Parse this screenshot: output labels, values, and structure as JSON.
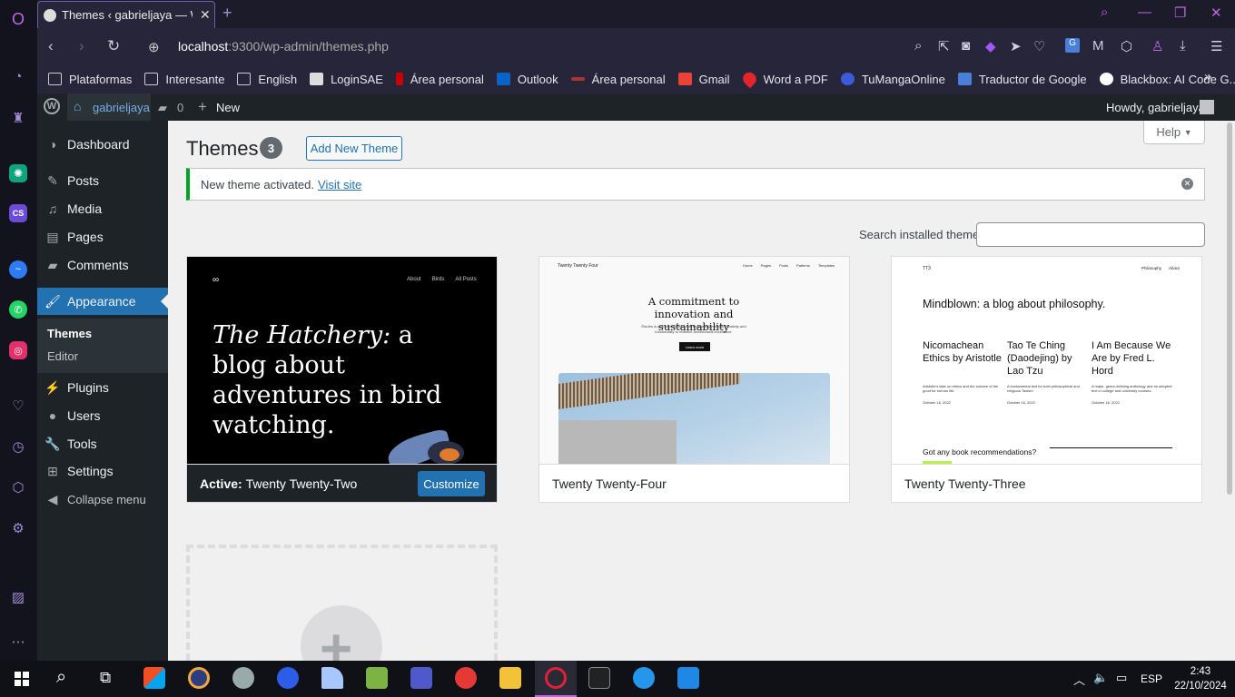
{
  "browser": {
    "tab_title": "Themes ‹ gabrieljaya — Wo",
    "url_host": "localhost",
    "url_path": ":9300/wp-admin/themes.php",
    "bookmarks": [
      "Plataformas",
      "Interesante",
      "English",
      "LoginSAE",
      "Área personal",
      "Outlook",
      "Área personal",
      "Gmail",
      "Word a PDF",
      "TuMangaOnline",
      "Traductor de Google",
      "Blackbox: AI Code G..."
    ]
  },
  "adminbar": {
    "site": "gabrieljaya",
    "comments": "0",
    "new": "New",
    "howdy": "Howdy, gabrieljaya"
  },
  "menu": {
    "dashboard": "Dashboard",
    "posts": "Posts",
    "media": "Media",
    "pages": "Pages",
    "comments": "Comments",
    "appearance": "Appearance",
    "themes": "Themes",
    "editor": "Editor",
    "plugins": "Plugins",
    "users": "Users",
    "tools": "Tools",
    "settings": "Settings",
    "collapse": "Collapse menu"
  },
  "page": {
    "title": "Themes",
    "count": "3",
    "add_new": "Add New Theme",
    "help": "Help",
    "notice": "New theme activated.",
    "visit_site": "Visit site",
    "search_label": "Search installed themes"
  },
  "themes": {
    "active_label": "Active:",
    "active_name": "Twenty Twenty-Two",
    "customize": "Customize",
    "t1_nav": [
      "About",
      "Birds",
      "All Posts"
    ],
    "t1_title_italic": "The Hatchery:",
    "t1_title_rest": " a blog about adventures in bird watching.",
    "t2_name": "Twenty Twenty-Four",
    "t2_brand": "Twenty Twenty Four",
    "t2_nav": [
      "Home",
      "Pages",
      "Posts",
      "Patterns",
      "Templates"
    ],
    "t2_headline": "A commitment to innovation and sustainability",
    "t2_body": "Études is a pioneering firm that seamlessly merges creativity and functionality to redefine architectural excellence.",
    "t2_btn": "Learn more",
    "t3_name": "Twenty Twenty-Three",
    "t3_brand": "TT3",
    "t3_nav": [
      "Philosophy",
      "About"
    ],
    "t3_headline": "Mindblown: a blog about philosophy.",
    "t3_posts": [
      {
        "title": "Nicomachean Ethics by Aristotle",
        "excerpt": "Aristotle's take on ethics and the science of the good for human life.",
        "date": "October 16, 2022"
      },
      {
        "title": "Tao Te Ching (Daodejing) by Lao Tzu",
        "excerpt": "A fundamental text for both philosophical and religious Taoism",
        "date": "October 16, 2022"
      },
      {
        "title": "I Am Because We Are by Fred L. Hord",
        "excerpt": "A major, genre-defining anthology and an adopted text in college and university courses.",
        "date": "October 16, 2022"
      }
    ],
    "t3_footer": "Got any book recommendations?"
  },
  "taskbar": {
    "lang": "ESP",
    "time": "2:43",
    "date": "22/10/2024"
  },
  "colors": {
    "wp_blue": "#2271b1",
    "wp_dark": "#1d2327",
    "notice_green": "#00a32a",
    "opera_purple": "#c066e8"
  }
}
